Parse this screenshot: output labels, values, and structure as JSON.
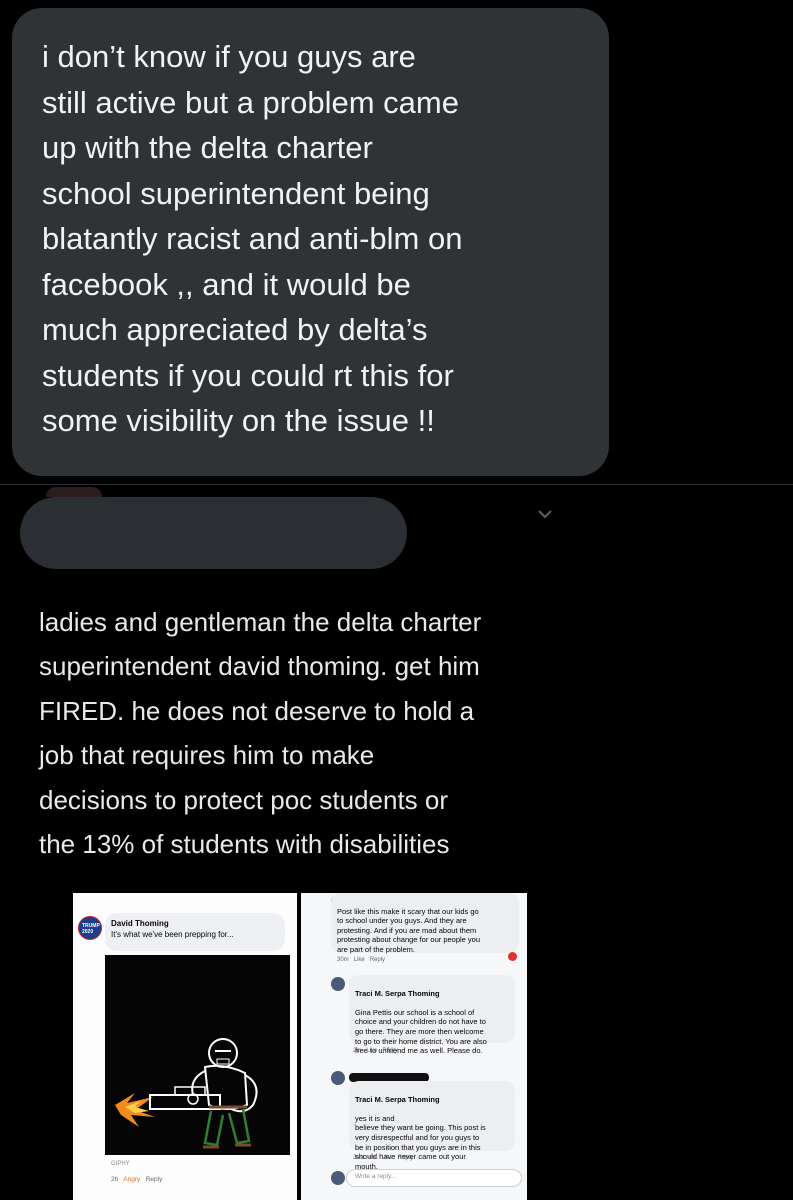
{
  "dm": {
    "text": "i don’t know if you guys are\nstill active but a problem came\nup with the delta charter\nschool superintendent being\nblatantly racist and anti-blm on\nfacebook ,, and it would be\nmuch appreciated by delta’s\nstudents if you could rt this for\nsome visibility on the issue !!"
  },
  "tweet": {
    "text": "ladies and gentleman the delta charter\nsuperintendent david thoming. get him\nFIRED. he does not deserve to hold a\njob that requires him to make\ndecisions to protect poc students or\nthe 13% of students with disabilities",
    "more_icon": "chevron-down-icon"
  },
  "media_left": {
    "badge": "TRUMP 2020",
    "author": "David Thoming",
    "body": "It's what we've been prepping for...",
    "giphy": "GIPHY",
    "time": "2h",
    "reaction": "Angry",
    "reply": "Reply"
  },
  "media_right": {
    "comment1": {
      "text": "Post like this make it scary that our kids go\nto school under you guys. And they are\nprotesting. And if you are mad about them\nprotesting about change for our people you\nare part of the problem.",
      "time": "30m",
      "like": "Like",
      "reply": "Reply"
    },
    "comment2": {
      "author": "Traci M. Serpa Thoming",
      "text": "Gina Pettis our school is a school of\nchoice and your children do not have to\ngo there. They are more then welcome\nto go to their home district. You are also\nfree to unfriend me as well. Please do.",
      "time": "2m",
      "like": "Like",
      "reply": "Reply"
    },
    "comment3": {
      "author": "Traci M. Serpa Thoming",
      "text": "yes it is and\nbelieve they want be going. This post is\nvery disrespectful and for you guys to\nbe in position that you guys are in this\nshould have never came out your\nmouth.",
      "time": "Just now",
      "like": "Like",
      "reply": "Reply"
    },
    "reply_placeholder": "Write a reply..."
  }
}
